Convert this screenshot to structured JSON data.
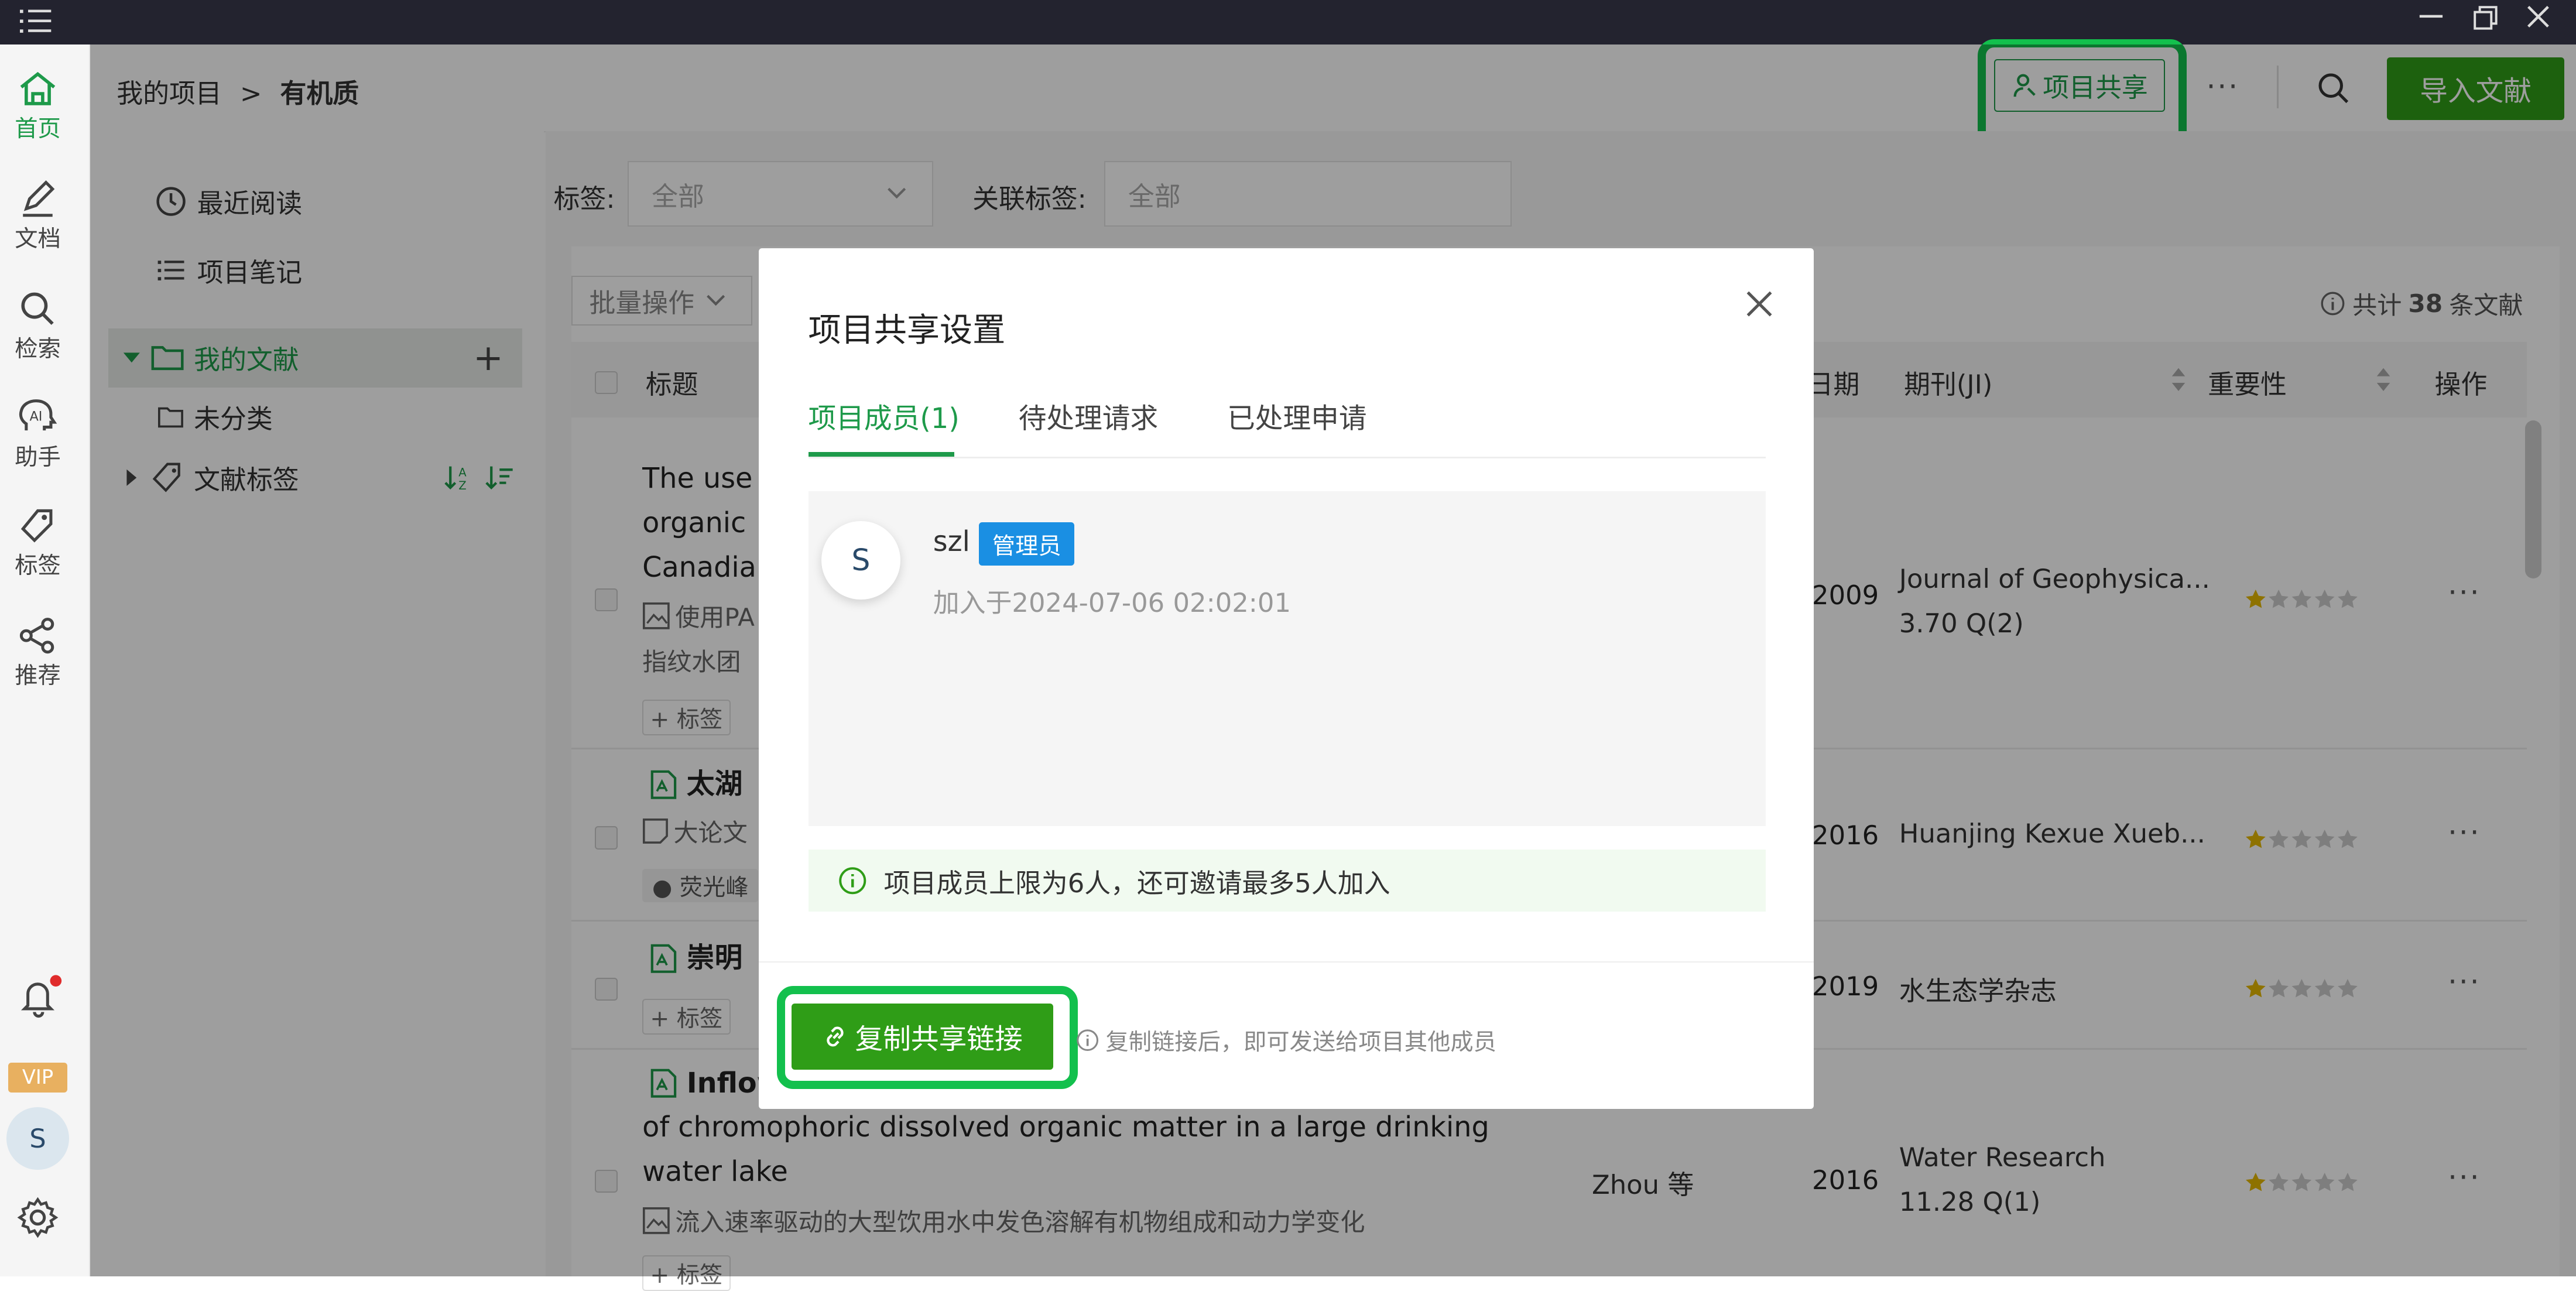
{
  "sidebar": {
    "items": [
      {
        "label": "首页",
        "icon": "home-icon"
      },
      {
        "label": "文档",
        "icon": "pen-icon"
      },
      {
        "label": "检索",
        "icon": "search-icon"
      },
      {
        "label": "助手",
        "icon": "ai-icon"
      },
      {
        "label": "标签",
        "icon": "tag-icon"
      },
      {
        "label": "推荐",
        "icon": "share-nodes-icon"
      }
    ],
    "vip": "VIP",
    "avatar": "S"
  },
  "header": {
    "breadcrumb_root": "我的项目",
    "breadcrumb_sep": ">",
    "breadcrumb_current": "有机质",
    "share_button": "项目共享",
    "more": "···",
    "import_button": "导入文献"
  },
  "left_panel": {
    "recent": "最近阅读",
    "notes": "项目笔记",
    "my_docs": "我的文献",
    "add": "+",
    "uncategorized": "未分类",
    "doc_tags": "文献标签"
  },
  "filters": {
    "tag_label": "标签:",
    "tag_value": "全部",
    "rel_tag_label": "关联标签:",
    "rel_tag_value": "全部"
  },
  "table": {
    "batch": "批量操作",
    "total_prefix": "共计",
    "total_count": "38",
    "total_suffix": "条文献",
    "headers": {
      "title": "标题",
      "date": "日期",
      "journal": "期刊(JI)",
      "importance": "重要性",
      "ops": "操作"
    },
    "rows": [
      {
        "title_lines": [
          "The use",
          "organic",
          "Canadia"
        ],
        "sub": "使用PA",
        "sub2": "指纹水团",
        "tag": "+ 标签",
        "author": "",
        "year": "2009",
        "journal": "Journal of Geophysica...",
        "jif": "3.70 Q(2)",
        "ops": "···"
      },
      {
        "title_lines": [
          "太湖"
        ],
        "sub": "大论文",
        "tag": "荧光峰",
        "author": "",
        "year": "2016",
        "journal": "Huanjing Kexue Xueb...",
        "jif": "",
        "ops": "···"
      },
      {
        "title_lines": [
          "崇明"
        ],
        "sub": "",
        "tag": "+ 标签",
        "author": "",
        "year": "2019",
        "journal": "水生态学杂志",
        "jif": "",
        "ops": "···"
      },
      {
        "title_lines": [
          "Inflow",
          "of chromophoric dissolved organic matter in a large drinking",
          "water lake"
        ],
        "sub": "流入速率驱动的大型饮用水中发色溶解有机物组成和动力学变化",
        "tag": "+ 标签",
        "author": "Zhou 等",
        "year": "2016",
        "journal": "Water Research",
        "jif": "11.28 Q(1)",
        "ops": "···"
      }
    ]
  },
  "modal": {
    "title": "项目共享设置",
    "close": "×",
    "tabs": [
      "项目成员(1)",
      "待处理请求",
      "已处理申请"
    ],
    "member": {
      "avatar": "S",
      "name": "szl",
      "role": "管理员",
      "joined": "加入于2024-07-06 02:02:01"
    },
    "notice": "项目成员上限为6人，还可邀请最多5人加入",
    "copy_button": "复制共享链接",
    "hint": "复制链接后，即可发送给项目其他成员"
  },
  "colors": {
    "accent": "#1e9a4a",
    "primary_button": "#2f9d17",
    "highlight": "#13c04d",
    "admin_badge": "#1a8fe3",
    "titlebar": "#23232f"
  }
}
